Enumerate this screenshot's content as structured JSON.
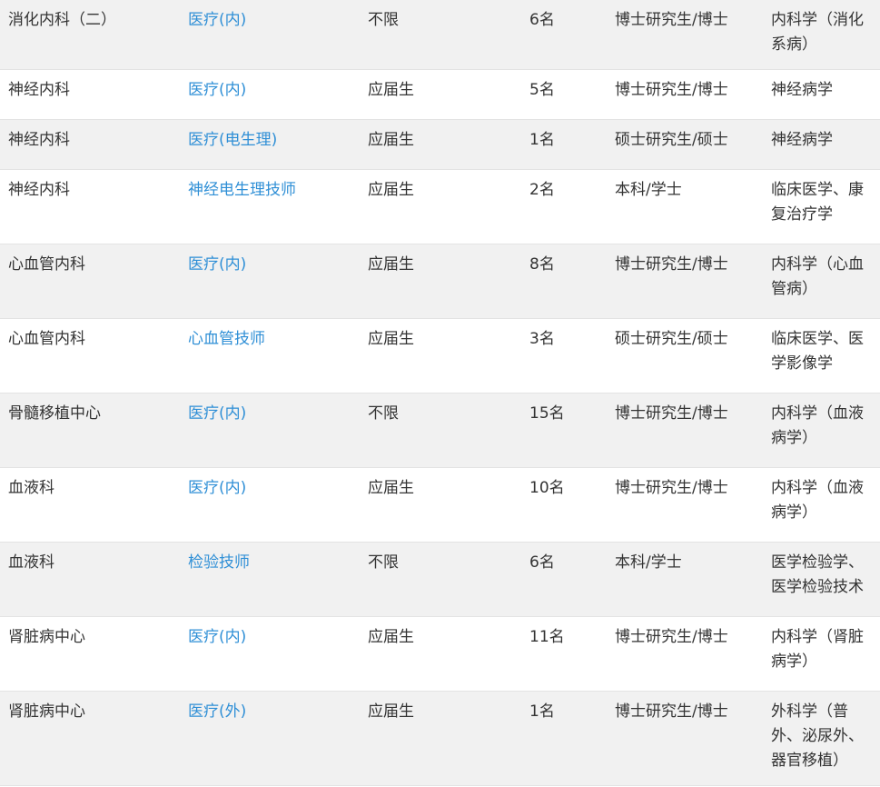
{
  "rows": [
    {
      "dept": "消化内科（二）",
      "position": "医疗(内)",
      "requirement": "不限",
      "count": "6名",
      "degree": "博士研究生/博士",
      "major": "内科学（消化系病）"
    },
    {
      "dept": "神经内科",
      "position": "医疗(内)",
      "requirement": "应届生",
      "count": "5名",
      "degree": "博士研究生/博士",
      "major": "神经病学"
    },
    {
      "dept": "神经内科",
      "position": "医疗(电生理)",
      "requirement": "应届生",
      "count": "1名",
      "degree": "硕士研究生/硕士",
      "major": "神经病学"
    },
    {
      "dept": "神经内科",
      "position": "神经电生理技师",
      "requirement": "应届生",
      "count": "2名",
      "degree": "本科/学士",
      "major": "临床医学、康复治疗学"
    },
    {
      "dept": "心血管内科",
      "position": "医疗(内)",
      "requirement": "应届生",
      "count": "8名",
      "degree": "博士研究生/博士",
      "major": "内科学（心血管病）"
    },
    {
      "dept": "心血管内科",
      "position": "心血管技师",
      "requirement": "应届生",
      "count": "3名",
      "degree": "硕士研究生/硕士",
      "major": "临床医学、医学影像学"
    },
    {
      "dept": "骨髓移植中心",
      "position": "医疗(内)",
      "requirement": "不限",
      "count": "15名",
      "degree": "博士研究生/博士",
      "major": "内科学（血液病学）"
    },
    {
      "dept": "血液科",
      "position": "医疗(内)",
      "requirement": "应届生",
      "count": "10名",
      "degree": "博士研究生/博士",
      "major": "内科学（血液病学）"
    },
    {
      "dept": "血液科",
      "position": "检验技师",
      "requirement": "不限",
      "count": "6名",
      "degree": "本科/学士",
      "major": "医学检验学、医学检验技术"
    },
    {
      "dept": "肾脏病中心",
      "position": "医疗(内)",
      "requirement": "应届生",
      "count": "11名",
      "degree": "博士研究生/博士",
      "major": "内科学（肾脏病学）"
    },
    {
      "dept": "肾脏病中心",
      "position": "医疗(外)",
      "requirement": "应届生",
      "count": "1名",
      "degree": "博士研究生/博士",
      "major": "外科学（普外、泌尿外、器官移植）"
    }
  ]
}
